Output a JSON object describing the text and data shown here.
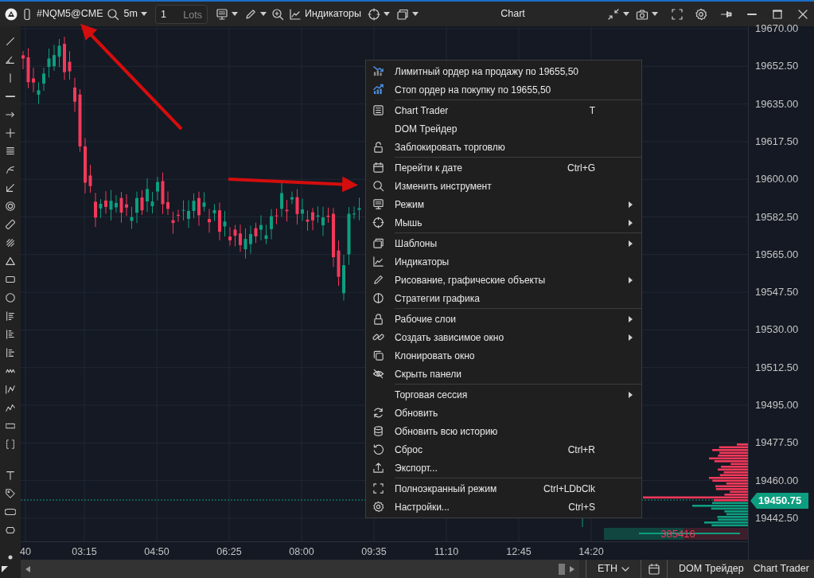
{
  "toolbar": {
    "symbol": "#NQM5@CME",
    "timeframe": "5m",
    "lots_value": "1",
    "lots_unit": "Lots",
    "indicators": "Индикаторы",
    "title": "Chart"
  },
  "chart": {
    "price_labels": [
      "19670.00",
      "19652.50",
      "19635.00",
      "19617.50",
      "19600.00",
      "19582.50",
      "19565.00",
      "19547.50",
      "19530.00",
      "19512.50",
      "19495.00",
      "19477.50",
      "19460.00",
      "19442.50"
    ],
    "current_price": "19450.75",
    "time_labels": [
      "40",
      "03:15",
      "04:50",
      "06:25",
      "08:00",
      "09:35",
      "11:10",
      "12:45",
      "14:20"
    ],
    "volume_total": "385416"
  },
  "context_menu": {
    "groups": [
      {
        "items": [
          {
            "label": "Лимитный ордер на продажу по 19655,50",
            "submenu": false
          },
          {
            "label": "Стоп ордер на покупку по 19655,50",
            "submenu": false
          }
        ]
      },
      {
        "items": [
          {
            "label": "Chart Trader",
            "shortcut": "T",
            "submenu": false
          },
          {
            "label": "DOM Трейдер",
            "submenu": false
          },
          {
            "label": "Заблокировать торговлю",
            "submenu": false
          }
        ]
      },
      {
        "items": [
          {
            "label": "Перейти к дате",
            "shortcut": "Ctrl+G",
            "submenu": false
          },
          {
            "label": "Изменить инструмент",
            "submenu": false
          },
          {
            "label": "Режим",
            "submenu": true
          },
          {
            "label": "Мышь",
            "submenu": true
          }
        ]
      },
      {
        "items": [
          {
            "label": "Шаблоны",
            "submenu": true
          },
          {
            "label": "Индикаторы",
            "submenu": false
          },
          {
            "label": "Рисование, графические объекты",
            "submenu": true
          },
          {
            "label": "Стратегии графика",
            "submenu": false
          }
        ]
      },
      {
        "items": [
          {
            "label": "Рабочие слои",
            "submenu": true
          },
          {
            "label": "Создать зависимое окно",
            "submenu": true
          },
          {
            "label": "Клонировать окно",
            "submenu": false
          },
          {
            "label": "Скрыть панели",
            "submenu": false
          }
        ]
      },
      {
        "items": [
          {
            "label": "Торговая сессия",
            "submenu": true
          },
          {
            "label": "Обновить",
            "submenu": false
          },
          {
            "label": "Обновить всю историю",
            "submenu": false
          },
          {
            "label": "Сброс",
            "shortcut": "Ctrl+R",
            "submenu": false
          },
          {
            "label": "Экспорт...",
            "submenu": false
          }
        ]
      },
      {
        "items": [
          {
            "label": "Полноэкранный режим",
            "shortcut": "Ctrl+LDbClk",
            "submenu": false
          },
          {
            "label": "Настройки...",
            "shortcut": "Ctrl+S",
            "submenu": false
          }
        ]
      }
    ]
  },
  "status_bar": {
    "session": "ETH",
    "buttons": [
      "DOM Трейдер",
      "Chart Trader"
    ]
  }
}
